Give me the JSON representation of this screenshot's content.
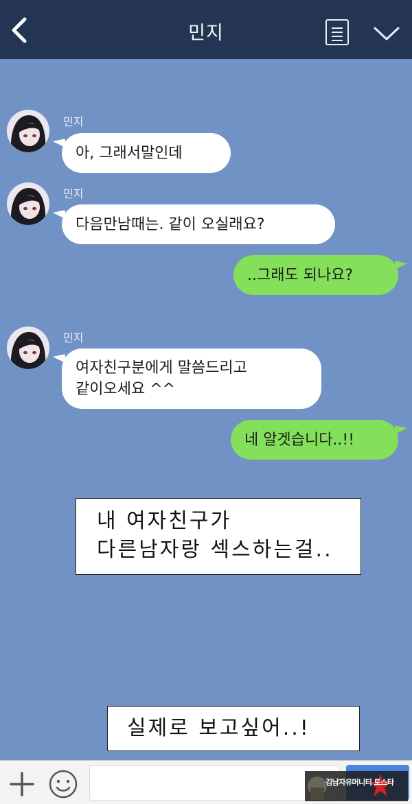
{
  "header": {
    "title": "민지",
    "back_icon": "chevron-left-icon",
    "menu_icon": "document-list-icon",
    "dropdown_icon": "chevron-down-icon"
  },
  "messages": [
    {
      "direction": "incoming",
      "sender": "민지",
      "text": "아, 그래서말인데"
    },
    {
      "direction": "incoming",
      "sender": "민지",
      "text": "다음만남때는. 같이 오실래요?"
    },
    {
      "direction": "outgoing",
      "text": "..그래도 되나요?"
    },
    {
      "direction": "incoming",
      "sender": "민지",
      "text": "여자친구분에게 말씀드리고\n같이오세요 ^^"
    },
    {
      "direction": "outgoing",
      "text": "네 알겟습니다..!!"
    }
  ],
  "captions": [
    {
      "text": "내 여자친구가\n다른남자랑 섹스하는걸.."
    },
    {
      "text": "실제로 보고싶어..!"
    }
  ],
  "input_bar": {
    "plus_icon": "plus-icon",
    "emoji_icon": "smiley-icon",
    "send_color": "#4a86e0"
  },
  "watermark": {
    "text": "김남자유머니티 토스타",
    "logo": "star-logo"
  },
  "colors": {
    "header": "#243453",
    "chat_background": "#7192c5",
    "incoming_bubble": "#ffffff",
    "outgoing_bubble": "#84e05a"
  }
}
